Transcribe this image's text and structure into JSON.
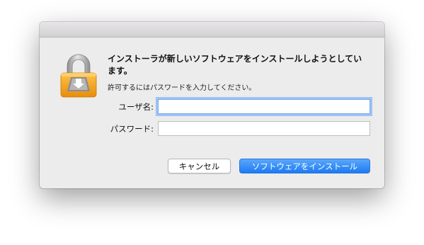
{
  "dialog": {
    "heading": "インストーラが新しいソフトウェアをインストールしようとしています。",
    "subtext": "許可するにはパスワードを入力してください。",
    "icon": "lock-download-icon",
    "colors": {
      "lock_body": "#f5a31a",
      "shackle": "#a8a8a8",
      "primary_button": "#1c7bf3",
      "focus_ring": "#9ec3f4"
    }
  },
  "form": {
    "username_label": "ユーザ名:",
    "username_value": "",
    "password_label": "パスワード:",
    "password_value": ""
  },
  "buttons": {
    "cancel_label": "キャンセル",
    "install_label": "ソフトウェアをインストール"
  }
}
